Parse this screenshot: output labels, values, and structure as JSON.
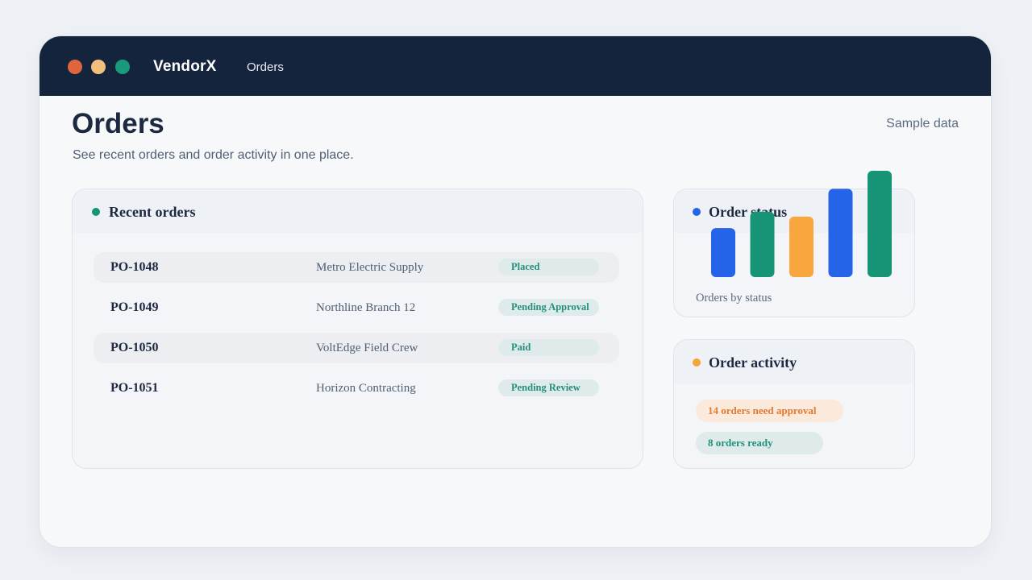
{
  "app": {
    "brand": "VendorX",
    "nav_item": "Orders"
  },
  "window_dots": [
    "#e0643e",
    "#f2c07a",
    "#1a9a7c"
  ],
  "page": {
    "title": "Orders",
    "subtitle": "See recent orders and order activity in one place.",
    "tag": "Sample data"
  },
  "recent_orders": {
    "title": "Recent orders",
    "dot_color": "#179475",
    "rows": [
      {
        "id": "PO-1048",
        "customer": "Metro Electric Supply",
        "status": "Placed"
      },
      {
        "id": "PO-1049",
        "customer": "Northline Branch 12",
        "status": "Pending Approval"
      },
      {
        "id": "PO-1050",
        "customer": "VoltEdge Field Crew",
        "status": "Paid"
      },
      {
        "id": "PO-1051",
        "customer": "Horizon Contracting",
        "status": "Pending Review"
      }
    ]
  },
  "order_status": {
    "title": "Order status",
    "dot_color": "#2563e8",
    "caption": "Orders by status"
  },
  "chart_data": {
    "type": "bar",
    "categories": [
      "",
      "",
      "",
      "",
      ""
    ],
    "values": [
      60,
      80,
      74,
      108,
      130
    ],
    "colors": [
      "#2563e8",
      "#179475",
      "#f8a63e",
      "#2563e8",
      "#179475"
    ],
    "ylim": [
      0,
      130
    ],
    "grid": false
  },
  "order_activity": {
    "title": "Order activity",
    "dot_color": "#f7a338",
    "items": [
      {
        "text": "14 orders need approval",
        "tone": "warning"
      },
      {
        "text": "8 orders ready",
        "tone": "success"
      }
    ]
  }
}
